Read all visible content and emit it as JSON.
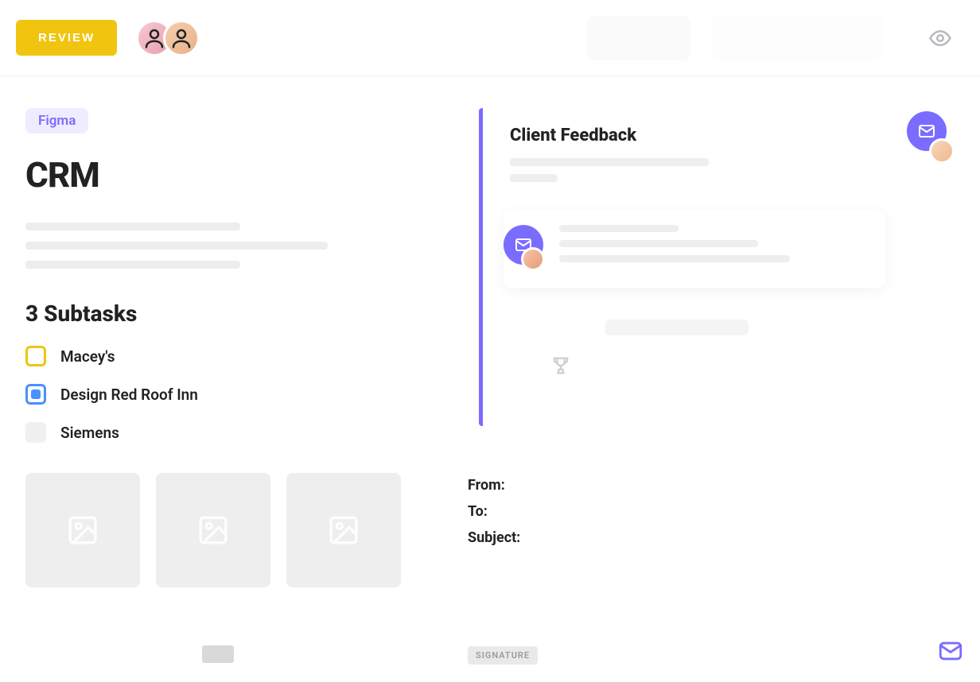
{
  "topbar": {
    "review_label": "REVIEW"
  },
  "left": {
    "tag": "Figma",
    "title": "CRM",
    "subtasks_heading": "3 Subtasks",
    "subtasks": [
      {
        "label": "Macey's",
        "status": "yellow"
      },
      {
        "label": "Design Red Roof Inn",
        "status": "blue"
      },
      {
        "label": "Siemens",
        "status": "grey"
      }
    ]
  },
  "feedback": {
    "title": "Client Feedback"
  },
  "email": {
    "from_label": "From:",
    "to_label": "To:",
    "subject_label": "Subject:",
    "signature_chip": "SIGNATURE"
  },
  "colors": {
    "accent_purple": "#7a6cff",
    "accent_yellow": "#f1c40f",
    "accent_blue": "#4a90ff"
  }
}
